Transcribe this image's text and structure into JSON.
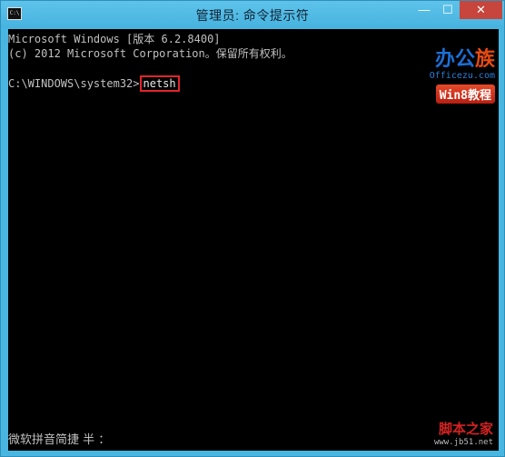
{
  "window": {
    "title": "管理员: 命令提示符",
    "icon_text": "C:\\",
    "controls": {
      "minimize": "—",
      "maximize": "☐",
      "close": "✕"
    }
  },
  "console": {
    "line1": "Microsoft Windows [版本 6.2.8400]",
    "line2": "(c) 2012 Microsoft Corporation。保留所有权利。",
    "prompt": "C:\\WINDOWS\\system32>",
    "command": "netsh",
    "ime_status": "微软拼音简捷 半 ："
  },
  "watermarks": {
    "logo_a": "办公",
    "logo_b": "族",
    "url": "Officezu.com",
    "badge": "Win8教程",
    "jb_name": "脚本之家",
    "jb_url": "www.jb51.net"
  },
  "colors": {
    "frame": "#48b6e0",
    "console_bg": "#000000",
    "console_text": "#c0c0c0",
    "highlight_border": "#e0242b",
    "close_button": "#c7453c"
  }
}
